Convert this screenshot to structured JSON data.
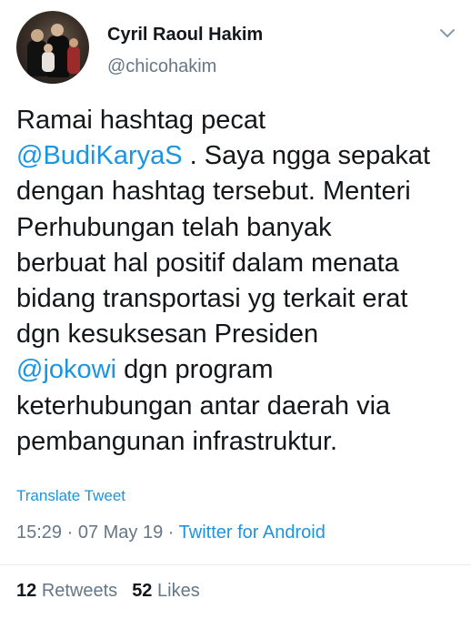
{
  "author": {
    "name": "Cyril Raoul Hakim",
    "handle": "@chicohakim"
  },
  "tweet": {
    "lines": [
      [
        {
          "text": "Ramai hashtag pecat",
          "type": "text"
        }
      ],
      [
        {
          "text": "@BudiKaryaS",
          "type": "mention"
        },
        {
          "text": " . Saya ngga sepakat",
          "type": "text"
        }
      ],
      [
        {
          "text": "dengan hashtag tersebut. Menteri",
          "type": "text"
        }
      ],
      [
        {
          "text": "Perhubungan telah banyak",
          "type": "text"
        }
      ],
      [
        {
          "text": "berbuat hal positif dalam menata",
          "type": "text"
        }
      ],
      [
        {
          "text": "bidang transportasi yg terkait erat",
          "type": "text"
        }
      ],
      [
        {
          "text": "dgn kesuksesan Presiden",
          "type": "text"
        }
      ],
      [
        {
          "text": "@jokowi",
          "type": "mention"
        },
        {
          "text": " dgn program",
          "type": "text"
        }
      ],
      [
        {
          "text": "keterhubungan antar daerah via",
          "type": "text"
        }
      ],
      [
        {
          "text": "pembangunan infrastruktur.",
          "type": "text"
        }
      ]
    ],
    "translate_label": "Translate Tweet",
    "time": "15:29",
    "separator": " · ",
    "date": "07 May 19",
    "source": "Twitter for Android"
  },
  "stats": {
    "retweets_count": "12",
    "retweets_label": "Retweets",
    "likes_count": "52",
    "likes_label": "Likes"
  },
  "icons": {
    "caret": "chevron-down-icon"
  },
  "colors": {
    "link": "#1b95e0",
    "secondary": "#657786",
    "primary": "#14171a",
    "divider": "#e6ecf0"
  }
}
